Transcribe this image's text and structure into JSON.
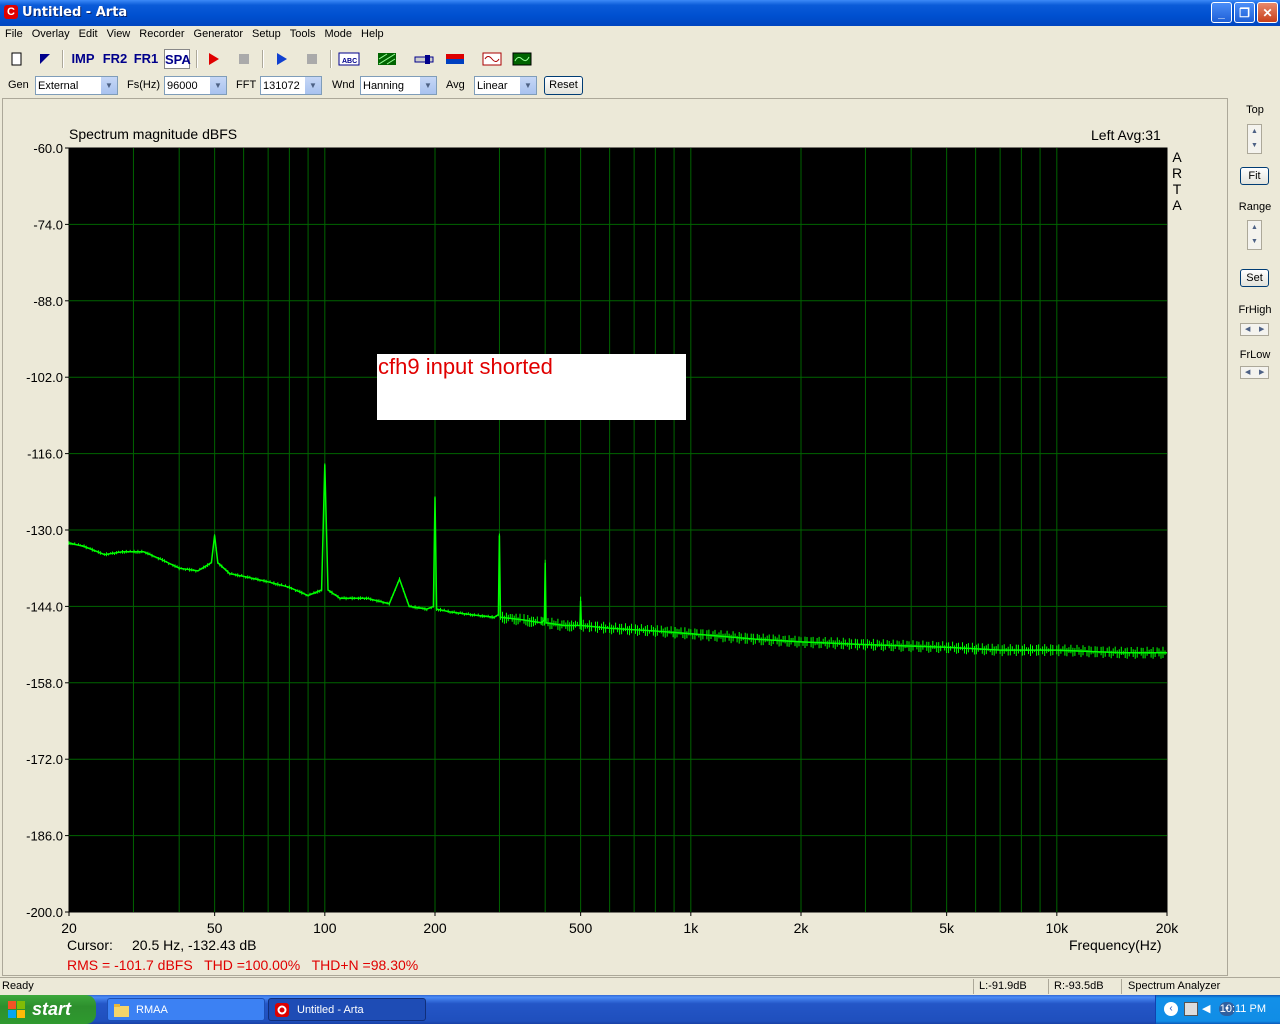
{
  "window": {
    "title": "Untitled - Arta",
    "app_icon": "C"
  },
  "menu": [
    "File",
    "Overlay",
    "Edit",
    "View",
    "Recorder",
    "Generator",
    "Setup",
    "Tools",
    "Mode",
    "Help"
  ],
  "toolbar": {
    "imp": "IMP",
    "fr2": "FR2",
    "fr1": "FR1",
    "spa": "SPA"
  },
  "controls": {
    "gen_label": "Gen",
    "gen_value": "External",
    "fs_label": "Fs(Hz)",
    "fs_value": "96000",
    "fft_label": "FFT",
    "fft_value": "131072",
    "wnd_label": "Wnd",
    "wnd_value": "Hanning",
    "avg_label": "Avg",
    "avg_value": "Linear",
    "reset": "Reset"
  },
  "plot": {
    "heading": "Spectrum magnitude dBFS",
    "channel": "Left  Avg:31",
    "brand": [
      "A",
      "R",
      "T",
      "A"
    ],
    "annotation": "cfh9 input shorted",
    "cursor_label": "Cursor:",
    "cursor_value": "20.5 Hz, -132.43 dB",
    "freq_label": "Frequency(Hz)",
    "metrics": "RMS = -101.7 dBFS   THD =100.00%   THD+N =98.30%"
  },
  "side": {
    "top": "Top",
    "fit": "Fit",
    "range": "Range",
    "set": "Set",
    "frhigh": "FrHigh",
    "frlow": "FrLow"
  },
  "status": {
    "ready": "Ready",
    "left": "L:-91.9dB",
    "right": "R:-93.5dB",
    "mode": "Spectrum Analyzer"
  },
  "taskbar": {
    "start": "start",
    "tasks": [
      "RMAA",
      "Untitled - Arta"
    ],
    "clock": "10:11 PM"
  },
  "chart_data": {
    "type": "line",
    "title": "Spectrum magnitude dBFS",
    "xlabel": "Frequency(Hz)",
    "ylabel": "",
    "xscale": "log",
    "xlim": [
      20,
      20000
    ],
    "ylim": [
      -200,
      -60
    ],
    "ytick_labels": [
      "-60.0",
      "-74.0",
      "-88.0",
      "-102.0",
      "-116.0",
      "-130.0",
      "-144.0",
      "-158.0",
      "-172.0",
      "-186.0",
      "-200.0"
    ],
    "xtick_labels": [
      {
        "v": 20,
        "label": "20"
      },
      {
        "v": 50,
        "label": "50"
      },
      {
        "v": 100,
        "label": "100"
      },
      {
        "v": 200,
        "label": "200"
      },
      {
        "v": 500,
        "label": "500"
      },
      {
        "v": 1000,
        "label": "1k"
      },
      {
        "v": 2000,
        "label": "2k"
      },
      {
        "v": 5000,
        "label": "5k"
      },
      {
        "v": 10000,
        "label": "10k"
      },
      {
        "v": 20000,
        "label": "20k"
      }
    ],
    "grid": true,
    "background": "#000000",
    "grid_color": "#006400",
    "line_color": "#00ff00",
    "series": [
      {
        "x": [
          20,
          22,
          25,
          28,
          32,
          36,
          40,
          45,
          49,
          50,
          51,
          55,
          60,
          70,
          80,
          90,
          98,
          100,
          102,
          110,
          130,
          150,
          160,
          170,
          190,
          198,
          200,
          202,
          220,
          250,
          290,
          298,
          300,
          302,
          350,
          390,
          398,
          400,
          402,
          450,
          490,
          498,
          500,
          502,
          600,
          800,
          1000,
          1500,
          2000,
          3000,
          5000,
          7000,
          10000,
          15000,
          20000
        ],
        "y": [
          -132.4,
          -133,
          -134.5,
          -134,
          -134,
          -135.5,
          -137,
          -137.5,
          -136,
          -131,
          -136,
          -138,
          -138.5,
          -139.5,
          -140.5,
          -142,
          -141,
          -118,
          -141,
          -142.5,
          -142.5,
          -143.5,
          -139,
          -144,
          -144.5,
          -144,
          -124,
          -144.5,
          -145,
          -145.5,
          -146,
          -145.5,
          -131,
          -146,
          -146.5,
          -147,
          -146.5,
          -136,
          -147,
          -147.5,
          -147.5,
          -147.5,
          -143,
          -147.5,
          -148,
          -148.5,
          -149,
          -150,
          -150.5,
          -151,
          -151.5,
          -152,
          -152,
          -152.5,
          -152.5
        ]
      }
    ]
  }
}
